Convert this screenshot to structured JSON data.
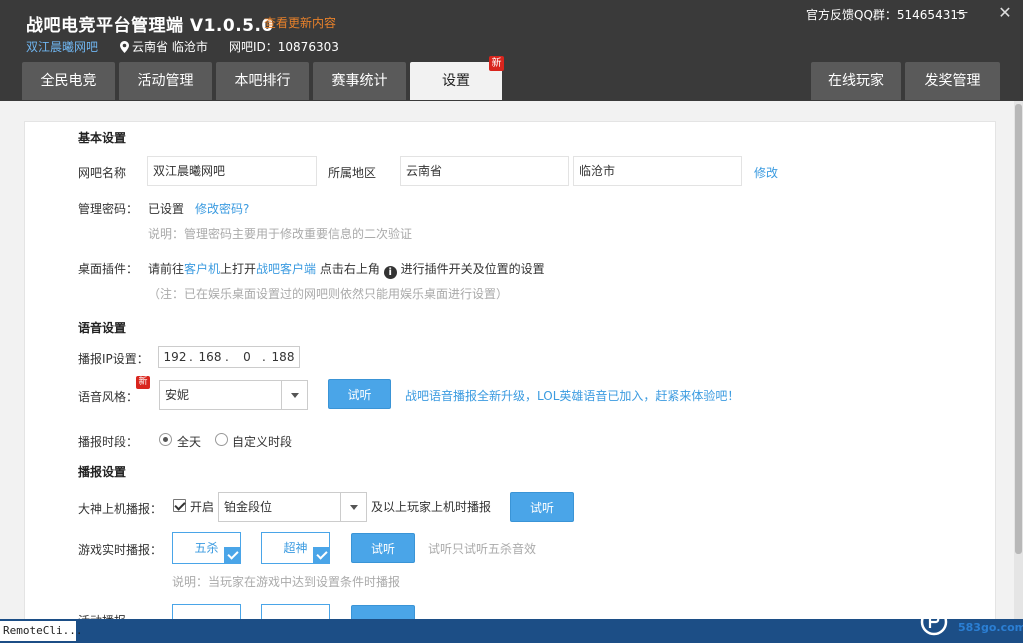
{
  "header": {
    "app_title": "战吧电竞平台管理端 V1.0.5.0",
    "update_link": "查看更新内容",
    "cafe_name": "双江晨曦网吧",
    "location": "云南省 临沧市",
    "cafe_id_label": "网吧ID：",
    "cafe_id": "10876303",
    "qq_feedback": "官方反馈QQ群：514654315",
    "minimize": "－",
    "close": "✕"
  },
  "tabs": [
    {
      "label": "全民电竞"
    },
    {
      "label": "活动管理"
    },
    {
      "label": "本吧排行"
    },
    {
      "label": "赛事统计"
    },
    {
      "label": "设置",
      "badge": "新",
      "active": true
    },
    {
      "label": "在线玩家"
    },
    {
      "label": "发奖管理"
    }
  ],
  "basic": {
    "title": "基本设置",
    "name_label": "网吧名称",
    "name_value": "双江晨曦网吧",
    "region_label": "所属地区",
    "province": "云南省",
    "city": "临沧市",
    "edit_link": "修改",
    "password_label": "管理密码：",
    "password_status": "已设置",
    "password_change": "修改密码?",
    "password_note": "说明：管理密码主要用于修改重要信息的二次验证",
    "plugin_label": "桌面插件：",
    "plugin_text1": "请前往",
    "plugin_link1": "客户机",
    "plugin_text2": "上打开",
    "plugin_link2": "战吧客户端",
    "plugin_text3": "点击右上角",
    "plugin_icon": "i",
    "plugin_text4": "进行插件开关及位置的设置",
    "plugin_note": "（注：已在娱乐桌面设置过的网吧则依然只能用娱乐桌面进行设置）"
  },
  "voice": {
    "title": "语音设置",
    "ip_label": "播报IP设置：",
    "ip": [
      "192",
      "168",
      "0",
      "188"
    ],
    "style_label": "语音风格：",
    "style_badge": "新",
    "style_value": "安妮",
    "listen": "试听",
    "promo": "战吧语音播报全新升级，LOL英雄语音已加入，赶紧来体验吧！",
    "period_label": "播报时段：",
    "period_all": "全天",
    "period_custom": "自定义时段"
  },
  "broadcast": {
    "title": "播报设置",
    "pro_label": "大神上机播报：",
    "pro_enable": "开启",
    "pro_rank": "铂金段位",
    "pro_suffix": "及以上玩家上机时播报",
    "listen": "试听",
    "realtime_label": "游戏实时播报：",
    "opt1": "五杀",
    "opt2": "超神",
    "realtime_note": "试听只试听五杀音效",
    "realtime_desc": "说明：当玩家在游戏中达到设置条件时播报",
    "activity_label": "活动播报"
  },
  "taskbar": {
    "remote": "RemoteCli..."
  },
  "watermark": {
    "text": "583go.com"
  },
  "colors": {
    "header_bg": "#3a3a3a",
    "accent": "#4aa5e8",
    "badge": "#d9251d",
    "update_link": "#e8812a"
  }
}
